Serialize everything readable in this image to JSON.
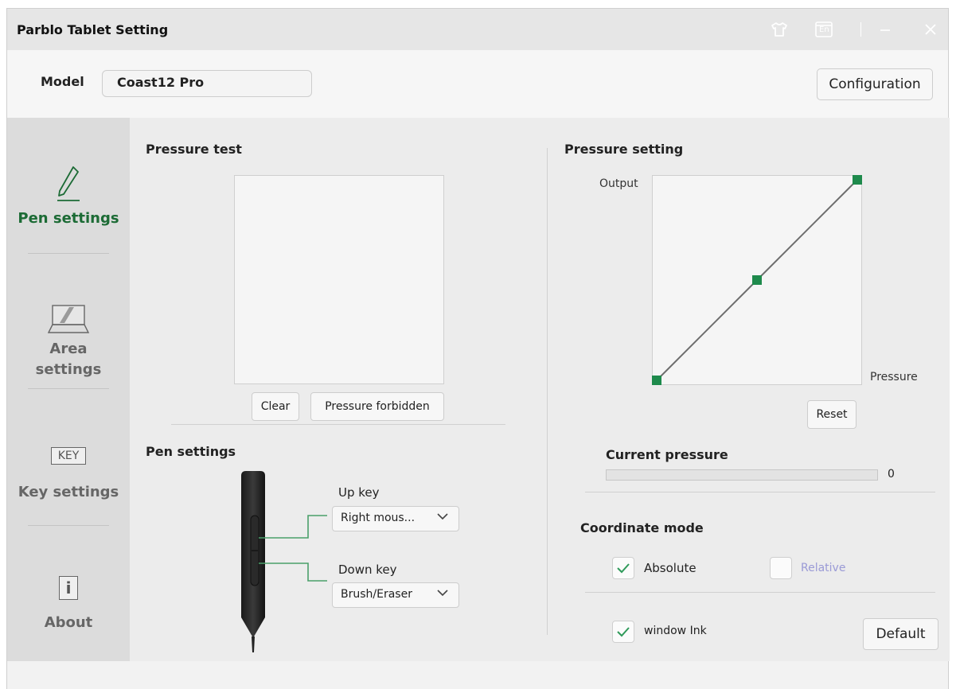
{
  "window": {
    "title": "Parblo Tablet Setting"
  },
  "titlebar": {
    "icons": [
      "skin-icon",
      "language-icon",
      "minimize-icon",
      "close-icon"
    ],
    "language_badge": "En"
  },
  "model": {
    "label": "Model",
    "value": "Coast12 Pro",
    "config_label": "Configuration"
  },
  "sidebar": {
    "items": [
      {
        "label": "Pen settings",
        "icon": "pen-icon",
        "active": true
      },
      {
        "label": "Area settings",
        "line1": "Area",
        "line2": "settings",
        "icon": "tablet-area-icon",
        "active": false
      },
      {
        "label": "Key settings",
        "icon": "key-icon",
        "badge": "KEY",
        "active": false
      },
      {
        "label": "About",
        "icon": "info-icon",
        "badge": "i",
        "active": false
      }
    ]
  },
  "pressure_test": {
    "title": "Pressure test",
    "clear_label": "Clear",
    "forbidden_label": "Pressure forbidden"
  },
  "pen_settings": {
    "title": "Pen settings",
    "up_key_label": "Up key",
    "up_key_value": "Right mous...",
    "down_key_label": "Down key",
    "down_key_value": "Brush/Eraser"
  },
  "pressure_setting": {
    "title": "Pressure setting",
    "output_label": "Output",
    "pressure_label": "Pressure",
    "reset_label": "Reset",
    "curve_points": [
      [
        0,
        0
      ],
      [
        0.5,
        0.5
      ],
      [
        1,
        1
      ]
    ]
  },
  "current_pressure": {
    "title": "Current pressure",
    "value": "0",
    "fraction": 0
  },
  "coordinate_mode": {
    "title": "Coordinate mode",
    "absolute_label": "Absolute",
    "absolute_checked": true,
    "relative_label": "Relative",
    "relative_checked": false
  },
  "windows_ink": {
    "label": "window Ink",
    "checked": true
  },
  "default_label": "Default",
  "colors": {
    "accent": "#1e8a4c",
    "active_text": "#1c6b35"
  }
}
